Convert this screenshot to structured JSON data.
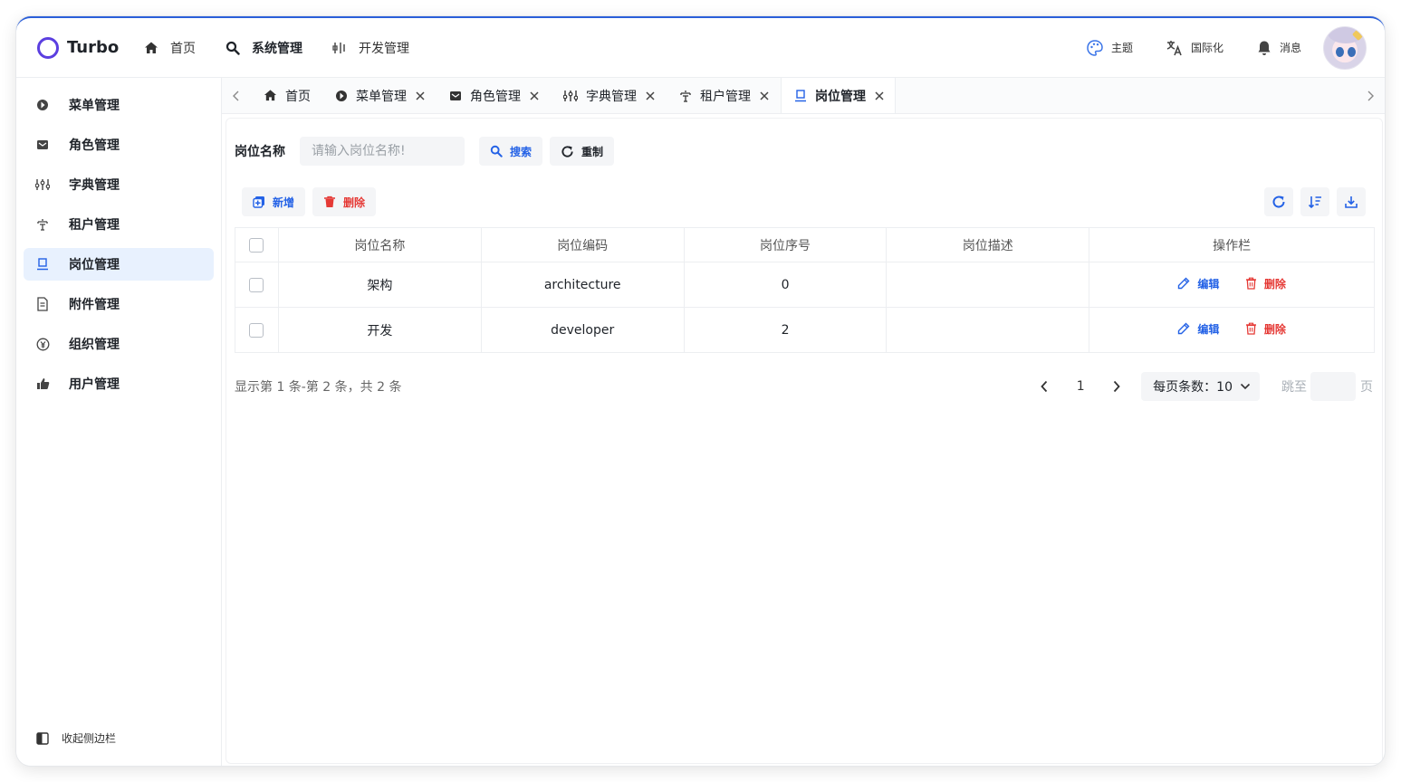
{
  "app": {
    "name": "Turbo"
  },
  "topnav": [
    {
      "label": "首页",
      "icon": "home-icon"
    },
    {
      "label": "系统管理",
      "icon": "search-icon",
      "active": true
    },
    {
      "label": "开发管理",
      "icon": "dev-icon"
    }
  ],
  "header_right": {
    "theme": "主题",
    "i18n": "国际化",
    "messages": "消息"
  },
  "sidebar": {
    "items": [
      {
        "label": "菜单管理",
        "icon": "menu-icon"
      },
      {
        "label": "角色管理",
        "icon": "role-icon"
      },
      {
        "label": "字典管理",
        "icon": "dict-icon"
      },
      {
        "label": "租户管理",
        "icon": "tenant-icon"
      },
      {
        "label": "岗位管理",
        "icon": "post-icon",
        "active": true
      },
      {
        "label": "附件管理",
        "icon": "file-icon"
      },
      {
        "label": "组织管理",
        "icon": "org-icon"
      },
      {
        "label": "用户管理",
        "icon": "user-icon"
      }
    ],
    "collapse_label": "收起侧边栏"
  },
  "tabs": [
    {
      "label": "首页",
      "closable": false
    },
    {
      "label": "菜单管理",
      "closable": true
    },
    {
      "label": "角色管理",
      "closable": true
    },
    {
      "label": "字典管理",
      "closable": true
    },
    {
      "label": "租户管理",
      "closable": true
    },
    {
      "label": "岗位管理",
      "closable": true,
      "active": true
    }
  ],
  "search": {
    "label": "岗位名称",
    "placeholder": "请输入岗位名称!",
    "value": "",
    "search_button": "搜索",
    "reset_button": "重制"
  },
  "toolbar": {
    "add_button": "新增",
    "delete_button": "删除"
  },
  "table": {
    "columns": [
      "岗位名称",
      "岗位编码",
      "岗位序号",
      "岗位描述",
      "操作栏"
    ],
    "rows": [
      {
        "name": "架构",
        "code": "architecture",
        "order": "0",
        "desc": "",
        "edit": "编辑",
        "delete": "删除"
      },
      {
        "name": "开发",
        "code": "developer",
        "order": "2",
        "desc": "",
        "edit": "编辑",
        "delete": "删除"
      }
    ]
  },
  "pagination": {
    "summary": "显示第 1 条-第 2 条，共 2 条",
    "current_page": "1",
    "page_size_label": "每页条数：10",
    "jump_label": "跳至",
    "jump_value": "",
    "page_suffix": "页"
  },
  "colors": {
    "primary": "#2462e6",
    "danger": "#e53935",
    "active_bg": "#e8f1fe",
    "logo": "#5b3fe0"
  }
}
